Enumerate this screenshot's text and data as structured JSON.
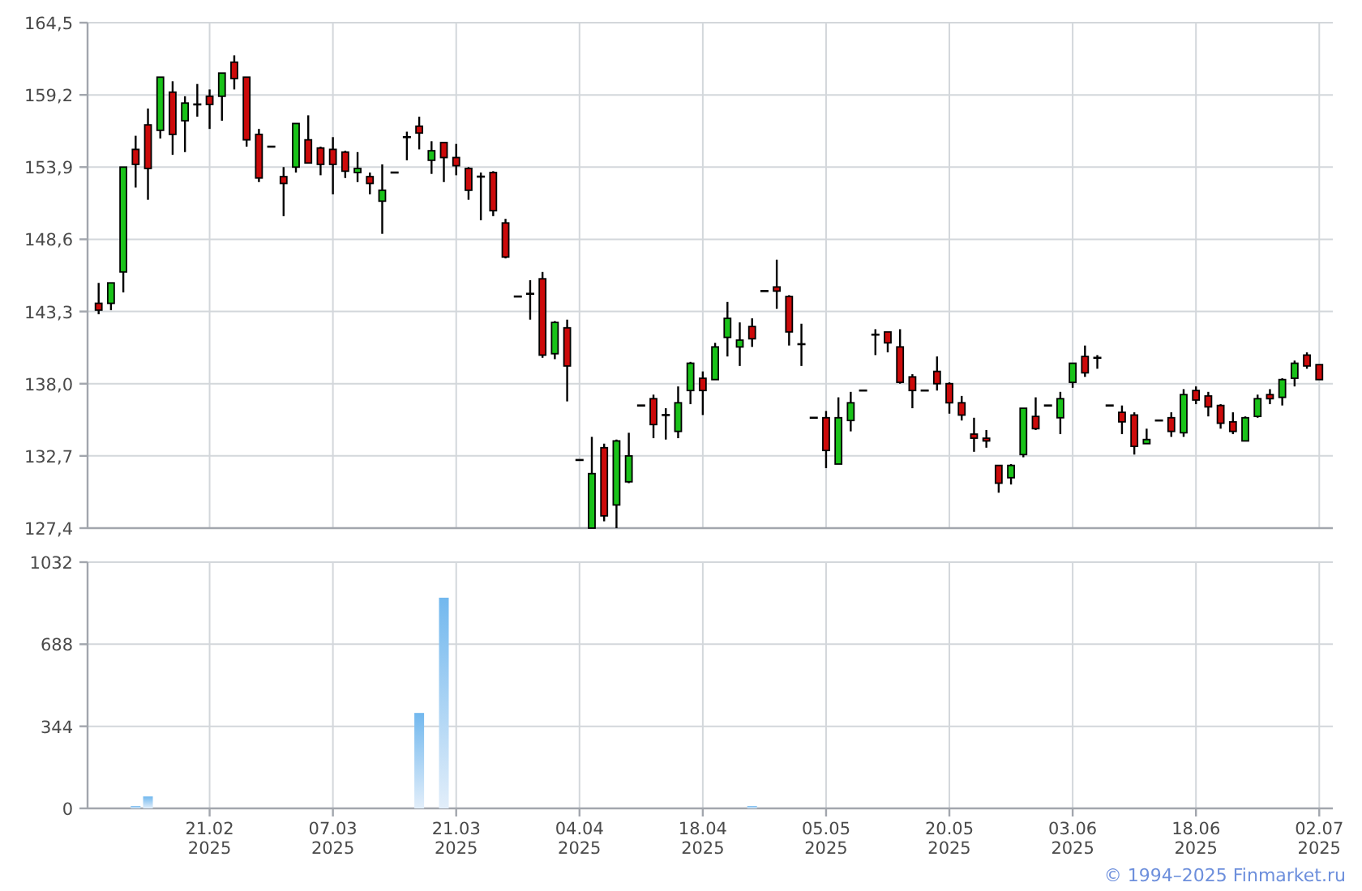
{
  "price_chart": {
    "chart_data": {
      "type": "candlestick",
      "grid": true,
      "ylim": [
        127.4,
        164.5
      ],
      "yticks": [
        {
          "value": 127.4,
          "label": "127,4"
        },
        {
          "value": 132.7,
          "label": "132,7"
        },
        {
          "value": 138.0,
          "label": "138,0"
        },
        {
          "value": 143.3,
          "label": "143,3"
        },
        {
          "value": 148.6,
          "label": "148,6"
        },
        {
          "value": 153.9,
          "label": "153,9"
        },
        {
          "value": 159.2,
          "label": "159,2"
        },
        {
          "value": 164.5,
          "label": "164,5"
        }
      ],
      "categories": [
        null,
        null,
        null,
        null,
        null,
        null,
        null,
        null,
        null,
        null,
        null,
        null,
        null,
        null,
        null,
        null,
        null,
        null,
        null,
        null,
        null,
        null,
        null,
        null,
        null,
        null,
        null,
        null,
        null,
        null,
        null,
        null,
        null,
        null,
        null,
        null,
        null,
        null,
        null,
        null,
        null,
        null,
        null,
        null,
        null,
        null,
        null,
        null,
        null,
        null,
        null,
        null,
        null,
        null,
        null,
        null,
        null,
        null,
        null,
        null,
        null,
        null,
        null,
        null,
        null,
        null,
        null,
        null,
        null,
        null,
        null,
        null,
        null,
        null,
        null,
        null,
        null,
        null,
        null,
        null,
        null,
        null,
        null,
        null,
        null,
        null,
        null,
        null,
        null,
        null,
        null,
        null,
        null,
        null,
        null,
        null,
        null,
        null,
        null,
        null
      ],
      "ohlc": [
        [
          143.9,
          145.4,
          143.1,
          143.4
        ],
        [
          143.9,
          145.4,
          143.4,
          145.4
        ],
        [
          146.2,
          153.9,
          144.7,
          153.9
        ],
        [
          155.2,
          156.2,
          152.4,
          154.1
        ],
        [
          157.0,
          158.2,
          151.5,
          153.8
        ],
        [
          156.6,
          160.5,
          156.0,
          160.5
        ],
        [
          159.4,
          160.2,
          154.8,
          156.3
        ],
        [
          157.3,
          159.1,
          155.0,
          158.6
        ],
        [
          158.5,
          160.0,
          157.6,
          158.5
        ],
        [
          159.1,
          159.6,
          156.7,
          158.5
        ],
        [
          159.1,
          160.8,
          157.3,
          160.8
        ],
        [
          161.6,
          162.1,
          159.6,
          160.4
        ],
        [
          160.5,
          160.5,
          155.4,
          155.9
        ],
        [
          156.3,
          156.7,
          152.8,
          153.1
        ],
        [
          155.4,
          155.4,
          155.4,
          155.4
        ],
        [
          153.2,
          153.9,
          150.3,
          152.7
        ],
        [
          153.9,
          157.1,
          153.5,
          157.1
        ],
        [
          155.9,
          157.7,
          154.2,
          154.2
        ],
        [
          155.3,
          155.4,
          153.3,
          154.1
        ],
        [
          155.2,
          156.1,
          151.9,
          154.1
        ],
        [
          155.0,
          155.1,
          153.1,
          153.6
        ],
        [
          153.5,
          155.0,
          152.8,
          153.8
        ],
        [
          153.2,
          153.5,
          151.9,
          152.7
        ],
        [
          151.4,
          154.1,
          149.0,
          152.2
        ],
        [
          153.5,
          153.5,
          153.5,
          153.5
        ],
        [
          156.1,
          156.5,
          154.4,
          156.1
        ],
        [
          156.9,
          157.6,
          155.2,
          156.4
        ],
        [
          154.4,
          155.8,
          153.4,
          155.1
        ],
        [
          155.7,
          155.7,
          152.8,
          154.6
        ],
        [
          154.6,
          155.6,
          153.3,
          154.0
        ],
        [
          153.8,
          153.9,
          151.5,
          152.2
        ],
        [
          153.2,
          153.5,
          150.0,
          153.2
        ],
        [
          153.5,
          153.6,
          150.3,
          150.7
        ],
        [
          149.8,
          150.1,
          147.2,
          147.3
        ],
        [
          144.4,
          144.4,
          144.4,
          144.4
        ],
        [
          144.6,
          145.6,
          142.7,
          144.6
        ],
        [
          145.7,
          146.2,
          139.9,
          140.1
        ],
        [
          140.2,
          142.6,
          139.8,
          142.5
        ],
        [
          142.1,
          142.7,
          136.7,
          139.3
        ],
        [
          132.4,
          132.4,
          132.4,
          132.4
        ],
        [
          127.4,
          134.1,
          127.4,
          131.4
        ],
        [
          133.3,
          133.6,
          127.9,
          128.3
        ],
        [
          129.1,
          133.9,
          127.4,
          133.8
        ],
        [
          130.8,
          134.4,
          130.7,
          132.7
        ],
        [
          136.4,
          136.4,
          136.4,
          136.4
        ],
        [
          136.9,
          137.2,
          134.0,
          135.0
        ],
        [
          135.7,
          136.2,
          133.9,
          135.7
        ],
        [
          134.5,
          137.8,
          134.0,
          136.6
        ],
        [
          137.5,
          139.6,
          136.5,
          139.5
        ],
        [
          138.4,
          138.9,
          135.7,
          137.5
        ],
        [
          138.3,
          141.0,
          138.3,
          140.7
        ],
        [
          141.4,
          144.0,
          140.0,
          142.8
        ],
        [
          140.7,
          142.5,
          139.3,
          141.2
        ],
        [
          142.2,
          142.8,
          140.7,
          141.3
        ],
        [
          144.8,
          144.8,
          144.8,
          144.8
        ],
        [
          145.1,
          147.1,
          143.5,
          144.8
        ],
        [
          144.4,
          144.5,
          140.8,
          141.8
        ],
        [
          140.9,
          142.4,
          139.3,
          140.9
        ],
        [
          135.5,
          135.5,
          135.5,
          135.5
        ],
        [
          135.5,
          136.0,
          131.8,
          133.1
        ],
        [
          132.1,
          137.0,
          132.1,
          135.5
        ],
        [
          135.3,
          137.4,
          134.5,
          136.6
        ],
        [
          137.5,
          137.5,
          137.5,
          137.5
        ],
        [
          141.6,
          142.0,
          140.1,
          141.6
        ],
        [
          141.8,
          141.8,
          140.3,
          141.0
        ],
        [
          140.7,
          142.0,
          138.0,
          138.1
        ],
        [
          138.5,
          138.7,
          136.2,
          137.5
        ],
        [
          137.5,
          137.5,
          137.5,
          137.5
        ],
        [
          138.9,
          140.0,
          137.5,
          138.0
        ],
        [
          138.0,
          138.1,
          135.8,
          136.6
        ],
        [
          136.6,
          137.1,
          135.3,
          135.7
        ],
        [
          134.3,
          135.5,
          133.0,
          134.0
        ],
        [
          134.0,
          134.6,
          133.3,
          133.8
        ],
        [
          132.0,
          132.0,
          130.0,
          130.7
        ],
        [
          131.1,
          132.1,
          130.6,
          132.0
        ],
        [
          132.8,
          136.2,
          132.6,
          136.2
        ],
        [
          135.6,
          137.0,
          134.6,
          134.7
        ],
        [
          136.4,
          136.4,
          136.4,
          136.4
        ],
        [
          135.5,
          137.4,
          134.3,
          136.9
        ],
        [
          138.1,
          139.5,
          137.7,
          139.5
        ],
        [
          140.0,
          140.8,
          138.5,
          138.8
        ],
        [
          139.9,
          140.1,
          139.1,
          139.9
        ],
        [
          136.4,
          136.4,
          136.4,
          136.4
        ],
        [
          135.9,
          136.4,
          134.3,
          135.2
        ],
        [
          135.7,
          135.9,
          132.8,
          133.4
        ],
        [
          133.6,
          134.7,
          133.6,
          133.9
        ],
        [
          135.3,
          135.3,
          135.3,
          135.3
        ],
        [
          135.5,
          135.9,
          134.1,
          134.5
        ],
        [
          134.4,
          137.6,
          134.1,
          137.2
        ],
        [
          137.5,
          137.8,
          136.5,
          136.8
        ],
        [
          137.1,
          137.4,
          135.6,
          136.3
        ],
        [
          136.4,
          136.5,
          134.7,
          135.1
        ],
        [
          135.2,
          135.9,
          134.3,
          134.5
        ],
        [
          133.8,
          135.6,
          133.8,
          135.5
        ],
        [
          135.6,
          137.2,
          135.5,
          136.9
        ],
        [
          137.2,
          137.6,
          136.5,
          136.9
        ],
        [
          137.0,
          138.4,
          136.4,
          138.3
        ],
        [
          138.4,
          139.7,
          137.8,
          139.5
        ],
        [
          140.1,
          140.3,
          139.1,
          139.3
        ],
        [
          139.4,
          139.4,
          138.3,
          138.3
        ]
      ]
    }
  },
  "volume_chart": {
    "chart_data": {
      "type": "bar",
      "grid": true,
      "ylim": [
        0,
        1032
      ],
      "yticks": [
        0,
        344,
        688,
        1032
      ],
      "categories": [
        null,
        null,
        null,
        null,
        null,
        null,
        null,
        null,
        null,
        "21.02\n2025",
        null,
        null,
        null,
        null,
        null,
        null,
        null,
        null,
        null,
        "07.03\n2025",
        null,
        null,
        null,
        null,
        null,
        null,
        null,
        null,
        null,
        "21.03\n2025",
        null,
        null,
        null,
        null,
        null,
        null,
        null,
        null,
        null,
        "04.04\n2025",
        null,
        null,
        null,
        null,
        null,
        null,
        null,
        null,
        null,
        "18.04\n2025",
        null,
        null,
        null,
        null,
        null,
        null,
        null,
        null,
        null,
        "05.05\n2025",
        null,
        null,
        null,
        null,
        null,
        null,
        null,
        null,
        null,
        "20.05\n2025",
        null,
        null,
        null,
        null,
        null,
        null,
        null,
        null,
        null,
        "03.06\n2025",
        null,
        null,
        null,
        null,
        null,
        null,
        null,
        null,
        null,
        "18.06\n2025",
        null,
        null,
        null,
        null,
        null,
        null,
        null,
        null,
        null,
        "02.07\n2025"
      ],
      "values": [
        0,
        0,
        0,
        10,
        50,
        0,
        0,
        0,
        0,
        0,
        0,
        0,
        0,
        0,
        0,
        0,
        0,
        0,
        0,
        0,
        0,
        0,
        0,
        0,
        0,
        0,
        400,
        0,
        883,
        0,
        0,
        0,
        0,
        0,
        0,
        0,
        0,
        0,
        0,
        0,
        0,
        0,
        0,
        0,
        0,
        0,
        0,
        0,
        0,
        0,
        0,
        0,
        0,
        10,
        0,
        0,
        0,
        0,
        0,
        0,
        0,
        0,
        0,
        0,
        0,
        0,
        0,
        0,
        0,
        0,
        0,
        0,
        0,
        0,
        0,
        0,
        0,
        0,
        0,
        0,
        0,
        0,
        0,
        0,
        0,
        0,
        0,
        0,
        0,
        0,
        0,
        0,
        0,
        0,
        0,
        0,
        0,
        0,
        0,
        0
      ]
    }
  },
  "footer": {
    "copyright": "© 1994–2025 Finmarket.ru"
  }
}
